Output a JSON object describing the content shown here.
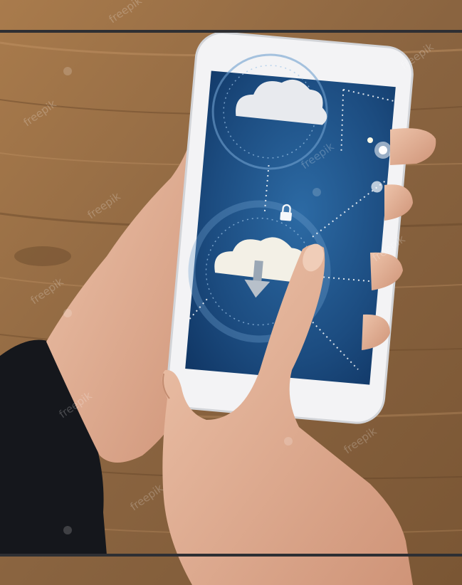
{
  "image": {
    "watermark_text": "freepik"
  },
  "palette": {
    "wood_light": "#b38654",
    "wood_dark": "#6e4d2e",
    "screen_blue": "#1e4f86",
    "screen_deep": "#0f3462",
    "skin": "#e4b39a",
    "sleeve": "#16181d",
    "rule": "#2e2f33"
  },
  "icons": [
    "cloud-icon",
    "cloud-download-icon",
    "lock-icon",
    "bulb-icon"
  ]
}
